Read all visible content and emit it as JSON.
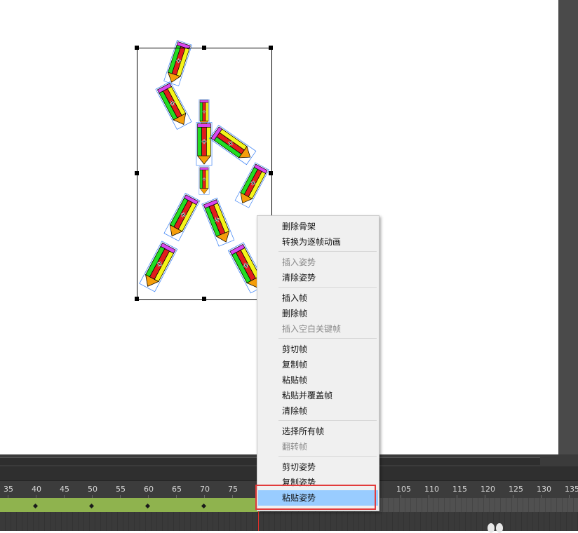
{
  "context_menu": {
    "items": [
      {
        "label": "删除骨架",
        "enabled": true
      },
      {
        "label": "转换为逐帧动画",
        "enabled": true
      },
      {
        "label": "插入姿势",
        "enabled": false
      },
      {
        "label": "清除姿势",
        "enabled": true
      },
      {
        "label": "插入帧",
        "enabled": true
      },
      {
        "label": "删除帧",
        "enabled": true
      },
      {
        "label": "插入空白关键帧",
        "enabled": false
      },
      {
        "label": "剪切帧",
        "enabled": true
      },
      {
        "label": "复制帧",
        "enabled": true
      },
      {
        "label": "粘贴帧",
        "enabled": true
      },
      {
        "label": "粘贴并覆盖帧",
        "enabled": true
      },
      {
        "label": "清除帧",
        "enabled": true
      },
      {
        "label": "选择所有帧",
        "enabled": true
      },
      {
        "label": "翻转帧",
        "enabled": false
      },
      {
        "label": "剪切姿势",
        "enabled": true
      },
      {
        "label": "复制姿势",
        "enabled": true
      },
      {
        "label": "粘贴姿势",
        "enabled": true,
        "hovered": true
      }
    ]
  },
  "timeline": {
    "ruler_labels": [
      "35",
      "40",
      "45",
      "50",
      "55",
      "60",
      "65",
      "70",
      "75",
      "105",
      "110",
      "115",
      "120",
      "125",
      "130",
      "135"
    ],
    "keyframe_frames": [
      40,
      50,
      60,
      70
    ],
    "colors": {
      "span": "#8fb34e",
      "playhead": "#e0302a",
      "highlight": "#e23b3b"
    }
  },
  "stage": {
    "armature_icon": "pencil-bone-armature"
  }
}
